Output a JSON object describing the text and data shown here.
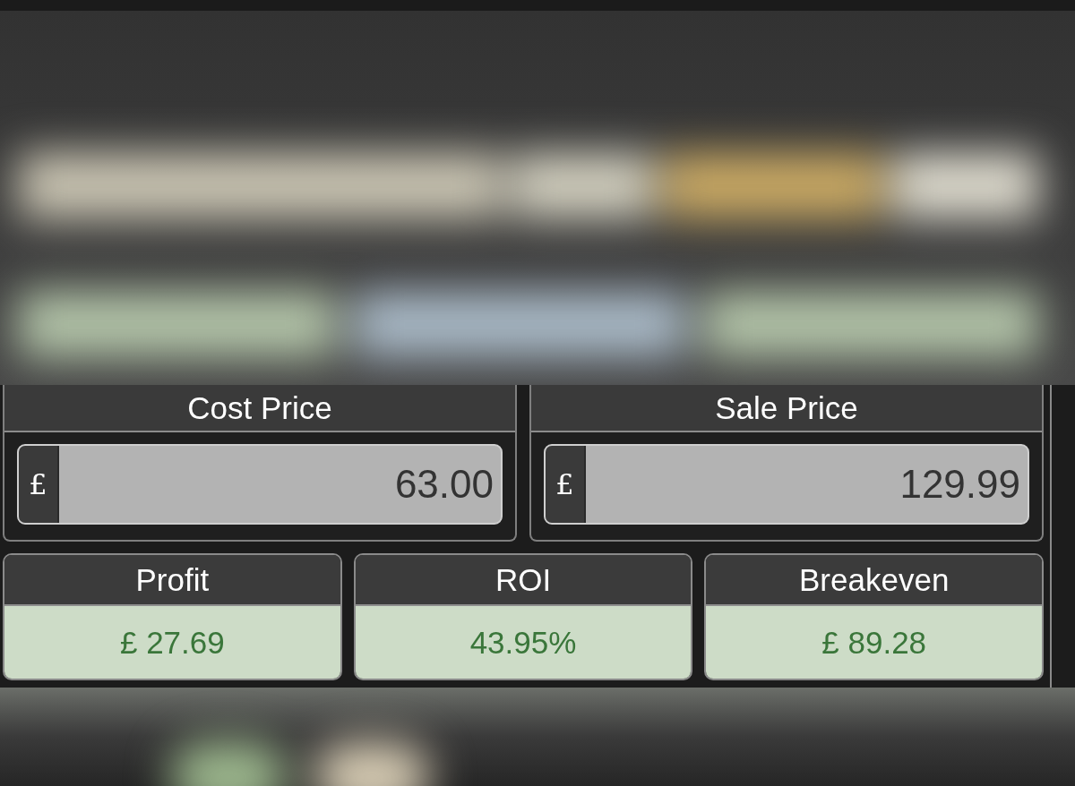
{
  "price_inputs": [
    {
      "label": "Cost Price",
      "currency": "£",
      "value": "63.00"
    },
    {
      "label": "Sale Price",
      "currency": "£",
      "value": "129.99"
    }
  ],
  "results": [
    {
      "label": "Profit",
      "value": "£ 27.69"
    },
    {
      "label": "ROI",
      "value": "43.95%"
    },
    {
      "label": "Breakeven",
      "value": "£ 89.28"
    }
  ]
}
